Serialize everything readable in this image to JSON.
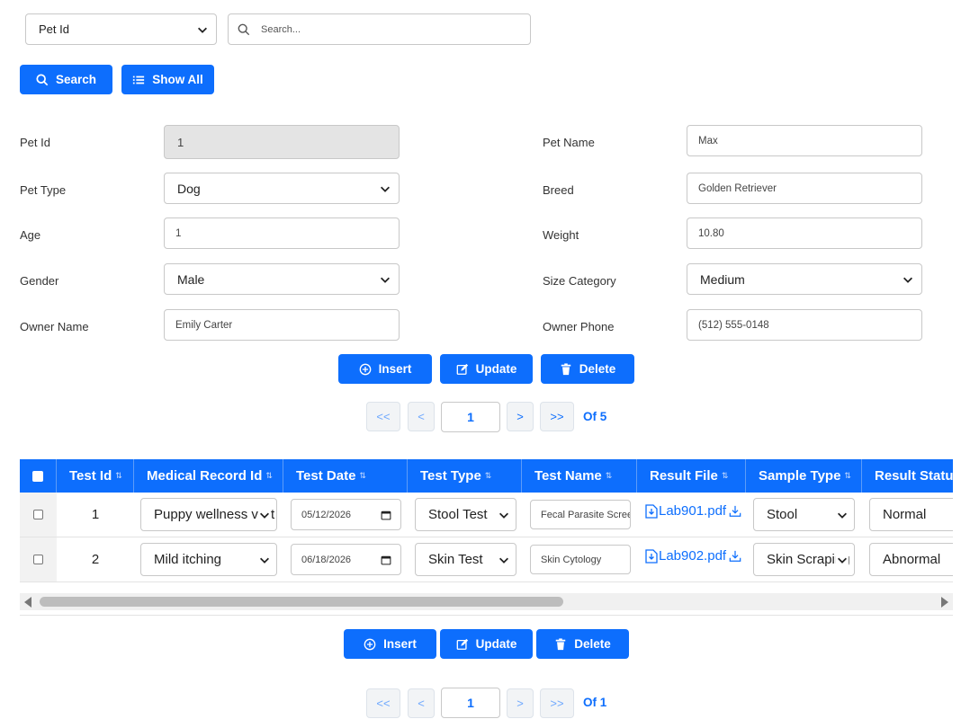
{
  "search": {
    "field_select": "Pet Id",
    "placeholder": "Search...",
    "search_label": "Search",
    "show_all_label": "Show All"
  },
  "form": {
    "pet_id_label": "Pet Id",
    "pet_id_value": "1",
    "pet_name_label": "Pet Name",
    "pet_name_value": "Max",
    "pet_type_label": "Pet Type",
    "pet_type_value": "Dog",
    "breed_label": "Breed",
    "breed_value": "Golden Retriever",
    "age_label": "Age",
    "age_value": "1",
    "weight_label": "Weight",
    "weight_value": "10.80",
    "gender_label": "Gender",
    "gender_value": "Male",
    "size_label": "Size Category",
    "size_value": "Medium",
    "owner_name_label": "Owner Name",
    "owner_name_value": "Emily Carter",
    "owner_phone_label": "Owner Phone",
    "owner_phone_value": "(512) 555-0148"
  },
  "actions": {
    "insert": "Insert",
    "update": "Update",
    "delete": "Delete"
  },
  "pager_top": {
    "first": "<<",
    "prev": "<",
    "page": "1",
    "next": ">",
    "last": ">>",
    "of": "Of 5"
  },
  "grid": {
    "headers": {
      "test_id": "Test Id",
      "medical_record_id": "Medical Record Id",
      "test_date": "Test Date",
      "test_type": "Test Type",
      "test_name": "Test Name",
      "result_file": "Result File",
      "sample_type": "Sample Type",
      "result_status": "Result Status"
    },
    "rows": [
      {
        "test_id": "1",
        "medical_record": "Puppy wellness visit",
        "test_date": "05/12/2026",
        "test_type": "Stool Test",
        "test_name": "Fecal Parasite Screen",
        "result_file": "Lab901.pdf",
        "sample_type": "Stool",
        "result_status": "Normal"
      },
      {
        "test_id": "2",
        "medical_record": "Mild itching",
        "test_date": "06/18/2026",
        "test_type": "Skin Test",
        "test_name": "Skin Cytology",
        "result_file": "Lab902.pdf",
        "sample_type": "Skin Scraping",
        "result_status": "Abnormal"
      }
    ]
  },
  "pager_bottom": {
    "first": "<<",
    "prev": "<",
    "page": "1",
    "next": ">",
    "last": ">>",
    "of": "Of 1"
  },
  "colors": {
    "primary": "#0d6efd",
    "disabled_input": "#e4e4e4"
  }
}
